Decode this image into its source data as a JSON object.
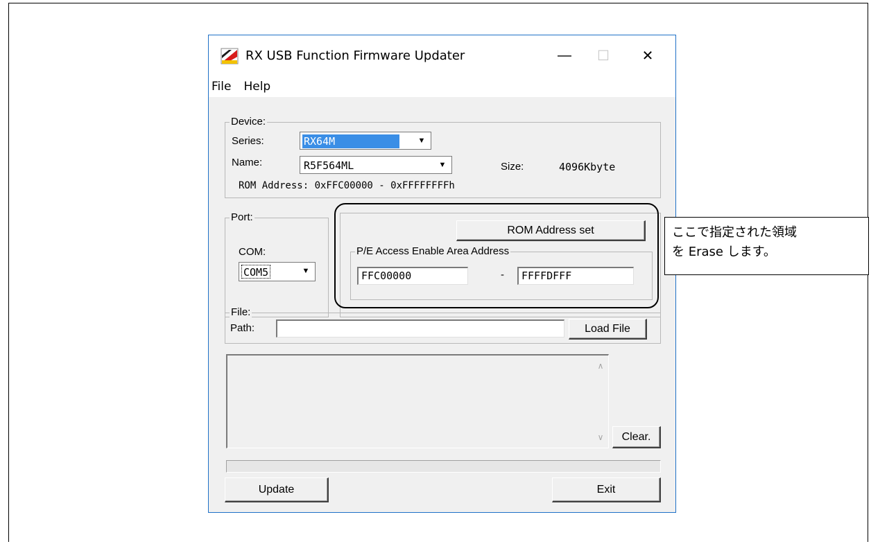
{
  "window": {
    "title": "RX USB Function Firmware Updater",
    "controls": {
      "minimize": "—",
      "maximize": "☐",
      "close": "✕"
    }
  },
  "menu": {
    "items": [
      "File",
      "Help"
    ]
  },
  "device": {
    "legend": "Device:",
    "series_label": "Series:",
    "series_value": "RX64M",
    "name_label": "Name:",
    "name_value": "R5F564ML",
    "size_label": "Size:",
    "size_value": "4096Kbyte",
    "rom_address": "ROM Address: 0xFFC00000 - 0xFFFFFFFFh"
  },
  "port": {
    "legend": "Port:",
    "com_label": "COM:",
    "com_value": "COM5"
  },
  "rom": {
    "set_button": "ROM Address set",
    "legend": "P/E Access Enable Area Address",
    "start": "FFC00000",
    "separator": "-",
    "end": "FFFFDFFF"
  },
  "file": {
    "legend": "File:",
    "path_label": "Path:",
    "path_value": "",
    "load_button": "Load File"
  },
  "log": {
    "clear_button": "Clear."
  },
  "actions": {
    "update": "Update",
    "exit": "Exit"
  },
  "callout": {
    "line1": "ここで指定された領域",
    "line2": "を Erase します。"
  },
  "colors": {
    "accent": "#1e70c7",
    "selection": "#3a8ee6"
  }
}
